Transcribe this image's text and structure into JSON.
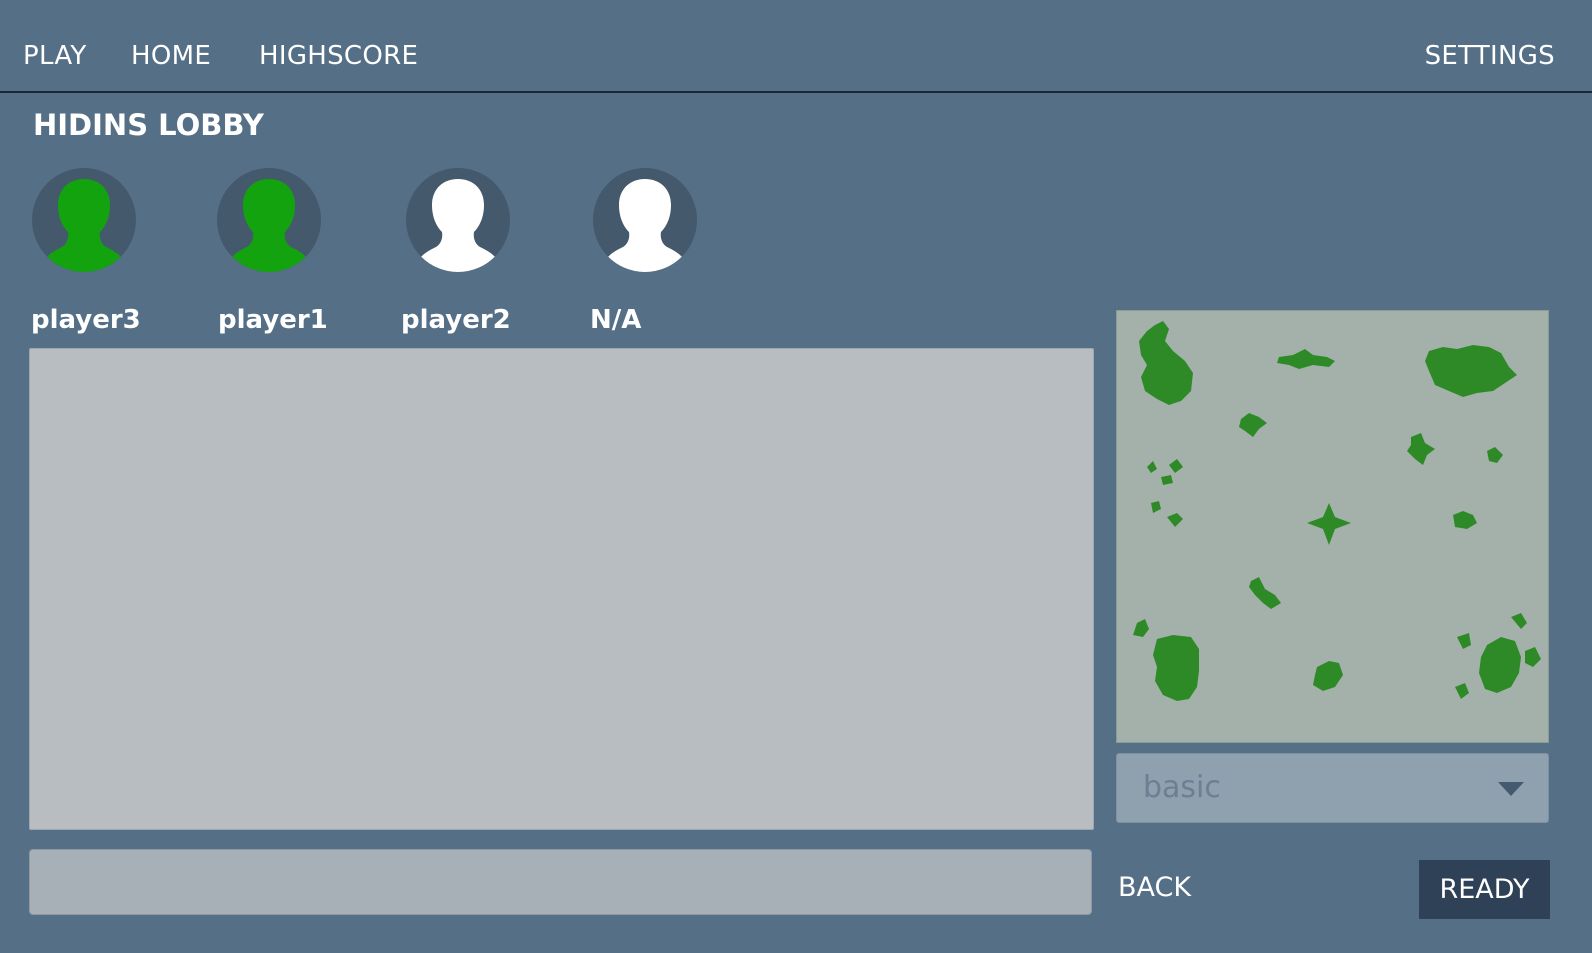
{
  "nav": {
    "play": "PLAY",
    "home": "HOME",
    "highscore": "HIGHSCORE",
    "settings": "SETTINGS"
  },
  "lobby": {
    "title": "HIDINS LOBBY",
    "slots": [
      {
        "name": "player3",
        "ready": true,
        "avatar_color": "#13a30f"
      },
      {
        "name": "player1",
        "ready": true,
        "avatar_color": "#13a30f"
      },
      {
        "name": "player2",
        "ready": false,
        "avatar_color": "#ffffff"
      },
      {
        "name": "N/A",
        "ready": false,
        "avatar_color": "#ffffff"
      }
    ]
  },
  "chat": {
    "input_value": ""
  },
  "map": {
    "selected": "basic",
    "island_color": "#2e8a27",
    "water_color": "#a4b1ab"
  },
  "actions": {
    "back": "BACK",
    "ready": "READY"
  },
  "colors": {
    "background": "#546f86",
    "ready_button": "#2f4156",
    "avatar_ring": "#44596c"
  }
}
